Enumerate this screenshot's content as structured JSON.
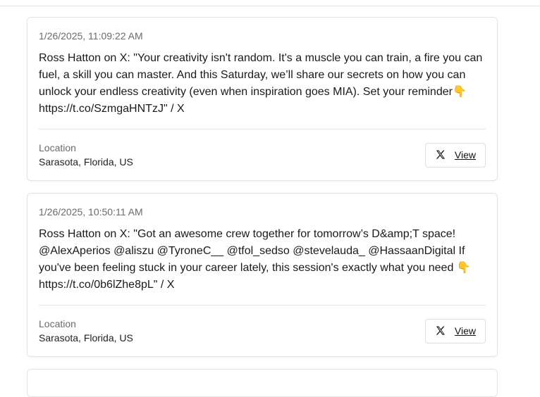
{
  "posts": [
    {
      "timestamp": "1/26/2025, 11:09:22 AM",
      "text": "Ross Hatton on X: \"Your creativity isn't random. It's a muscle you can train, a fire you can fuel, a skill you can master. And this Saturday, we’ll share our secrets on how you can unlock your endless creativity (even when inspiration goes MIA). Set your reminder👇 https://t.co/SzmgaHNTzJ\" / X",
      "location_label": "Location",
      "location_value": "Sarasota, Florida, US",
      "view_label": "View",
      "icon": "x-logo-icon"
    },
    {
      "timestamp": "1/26/2025, 10:50:11 AM",
      "text": "Ross Hatton on X: \"Got an awesome crew together for tomorrow’s D&amp;T space! @AlexAperios @aliszu @TyroneC__ @tfol_sedso @stevelauda_ @HassaanDigital If you've been feeling stuck in your career lately, this session's exactly what you need 👇 https://t.co/0b6lZhe8pL\" / X",
      "location_label": "Location",
      "location_value": "Sarasota, Florida, US",
      "view_label": "View",
      "icon": "x-logo-icon"
    }
  ]
}
